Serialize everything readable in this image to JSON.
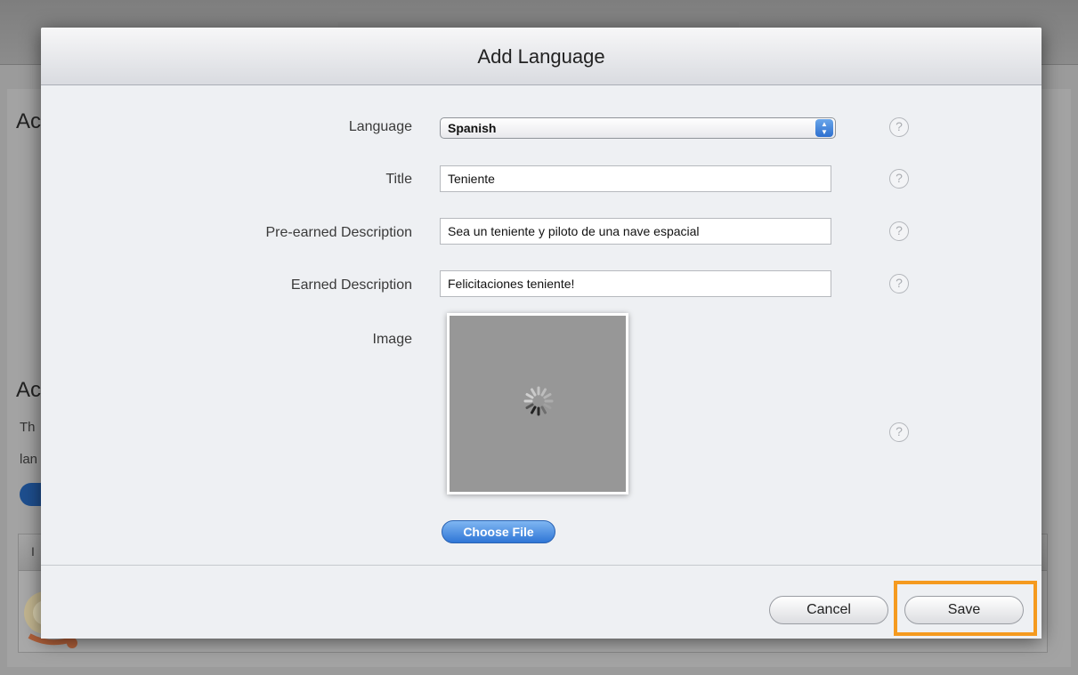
{
  "background": {
    "heading_1": "Ac",
    "heading_2": "Ac",
    "text_line_1": "Th",
    "text_line_2": "lan",
    "table_header": "I"
  },
  "modal": {
    "title": "Add Language",
    "fields": {
      "language": {
        "label": "Language",
        "value": "Spanish",
        "help": "?"
      },
      "title": {
        "label": "Title",
        "value": "Teniente",
        "help": "?"
      },
      "pre_earned": {
        "label": "Pre-earned Description",
        "value": "Sea un teniente y piloto de una nave espacial",
        "help": "?"
      },
      "earned": {
        "label": "Earned Description",
        "value": "Felicitaciones teniente!",
        "help": "?"
      },
      "image": {
        "label": "Image",
        "help": "?"
      }
    },
    "choose_file_label": "Choose File",
    "cancel_label": "Cancel",
    "save_label": "Save"
  },
  "colors": {
    "highlight": "#f59a1f",
    "accent_blue": "#2f76d6"
  }
}
